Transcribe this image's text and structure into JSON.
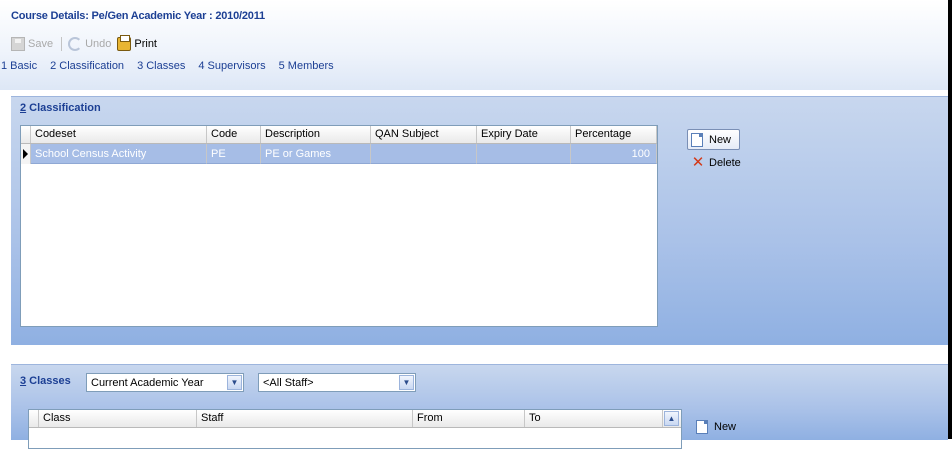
{
  "header": {
    "title": "Course Details: Pe/Gen  Academic Year : 2010/2011"
  },
  "toolbar": {
    "save_label": "Save",
    "undo_label": "Undo",
    "print_label": "Print"
  },
  "tabs": [
    {
      "label": "1 Basic"
    },
    {
      "label": "2 Classification"
    },
    {
      "label": "3 Classes"
    },
    {
      "label": "4 Supervisors"
    },
    {
      "label": "5 Members"
    }
  ],
  "classification": {
    "title_num": "2",
    "title_text": " Classification",
    "columns": [
      "Codeset",
      "Code",
      "Description",
      "QAN Subject",
      "Expiry Date",
      "Percentage"
    ],
    "rows": [
      {
        "codeset": "School Census Activity",
        "code": "PE",
        "description": "PE or Games",
        "qan_subject": "",
        "expiry_date": "",
        "percentage": "100"
      }
    ],
    "new_label": "New",
    "delete_label": "Delete"
  },
  "classes": {
    "title_num": "3",
    "title_text": " Classes",
    "year_filter": "Current Academic Year",
    "staff_filter": "<All Staff>",
    "columns": [
      "Class",
      "Staff",
      "From",
      "To"
    ],
    "new_label": "New"
  },
  "colors": {
    "accent": "#1c3f94",
    "panel": "#a9c1e8",
    "selected_row": "#a6bde6"
  }
}
